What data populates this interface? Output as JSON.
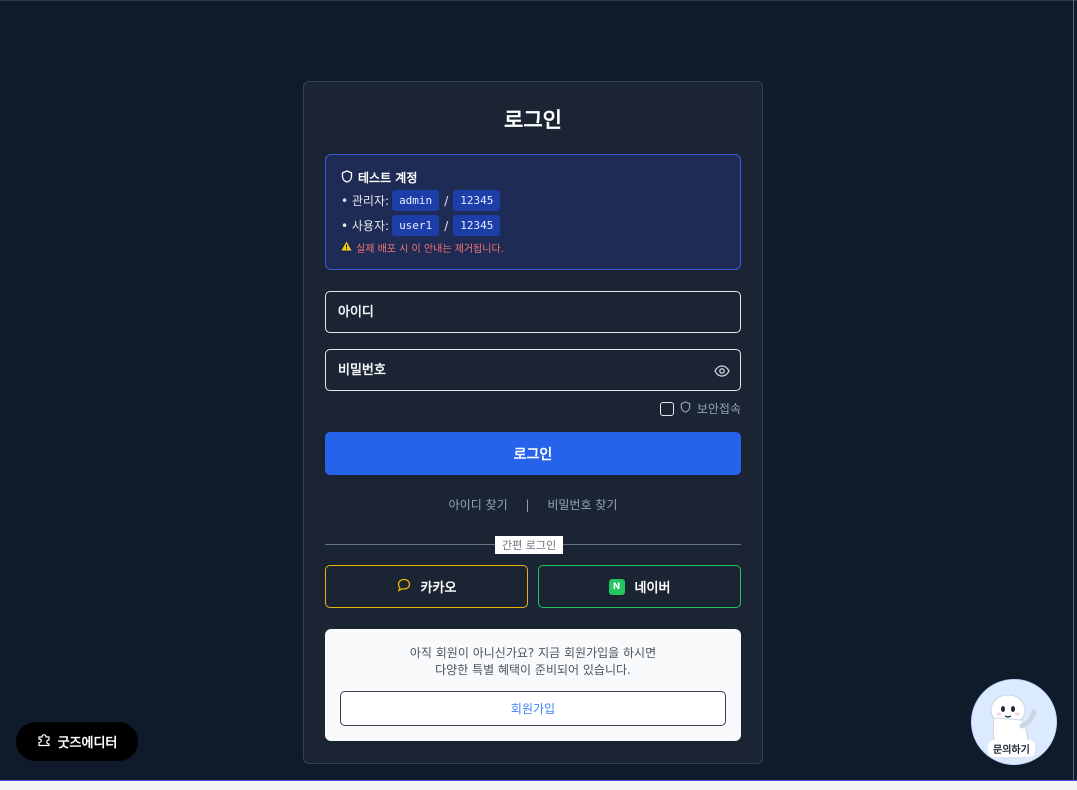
{
  "login": {
    "title": "로그인",
    "notice": {
      "heading": "테스트 계정",
      "admin_label": "• 관리자:",
      "admin_id": "admin",
      "admin_pw": "12345",
      "user_label": "• 사용자:",
      "user_id": "user1",
      "user_pw": "12345",
      "separator": "/",
      "warning": "실제 배포 시 이 안내는 제거됩니다."
    },
    "id_placeholder": "아이디",
    "pw_placeholder": "비밀번호",
    "secure_label": "보안접속",
    "submit_label": "로그인",
    "find_id": "아이디 찾기",
    "link_separator": "|",
    "find_pw": "비밀번호 찾기",
    "social_divider": "간편 로그인",
    "kakao_label": "카카오",
    "naver_label": "네이버",
    "naver_badge": "N",
    "signup": {
      "line1": "아직 회원이 아니신가요? 지금 회원가입을 하시면",
      "line2": "다양한 특별 혜택이 준비되어 있습니다.",
      "button": "회원가입"
    }
  },
  "floating": {
    "goods_editor": "굿즈에디터",
    "chat_label": "문의하기"
  },
  "colors": {
    "background": "#0f1b2a",
    "card": "#1b2433",
    "primary": "#2563eb",
    "kakao": "#eab308",
    "naver": "#22c55e",
    "warning": "#f87171"
  },
  "icons": [
    "shield-icon",
    "warning-icon",
    "eye-icon",
    "chat-bubble-icon",
    "puzzle-icon"
  ]
}
